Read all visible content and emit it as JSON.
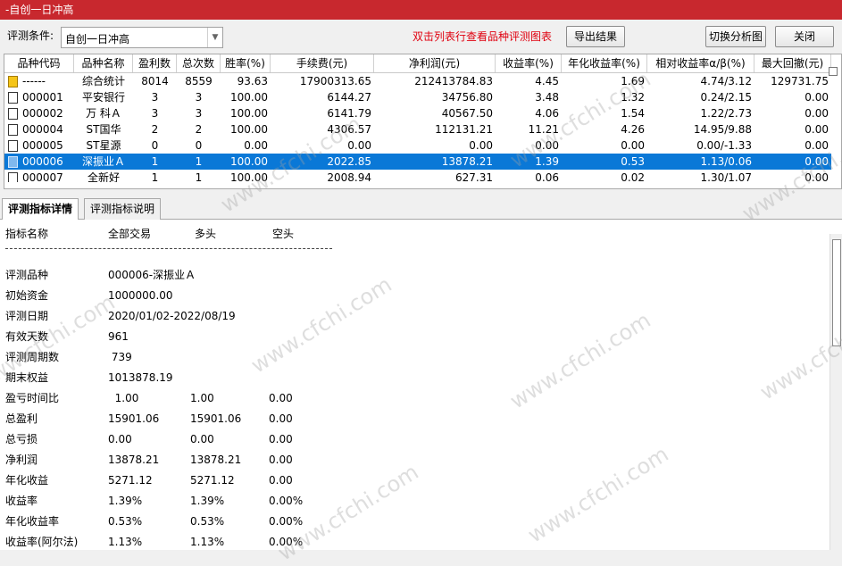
{
  "window": {
    "title": "-自创一日冲高"
  },
  "toolbar": {
    "condition_label": "评测条件:",
    "condition_value": "自创一日冲高",
    "hint": "双击列表行查看品种评测图表",
    "export_label": "导出结果",
    "switch_label": "切换分析图",
    "close_label": "关闭"
  },
  "grid": {
    "columns": [
      "品种代码",
      "品种名称",
      "盈利数",
      "总次数",
      "胜率(%)",
      "手续费(元)",
      "净利润(元)",
      "收益率(%)",
      "年化收益率(%)",
      "相对收益率α/β(%)",
      "最大回撤(元)"
    ],
    "rows": [
      {
        "code": "------",
        "name": "综合统计",
        "win": "8014",
        "total": "8559",
        "rate": "93.63",
        "fee": "17900313.65",
        "profit": "212413784.83",
        "ret": "4.45",
        "annual": "1.69",
        "rel": "4.74/3.12",
        "dd": "129731.75",
        "summary": true
      },
      {
        "code": "000001",
        "name": "平安银行",
        "win": "3",
        "total": "3",
        "rate": "100.00",
        "fee": "6144.27",
        "profit": "34756.80",
        "ret": "3.48",
        "annual": "1.32",
        "rel": "0.24/2.15",
        "dd": "0.00"
      },
      {
        "code": "000002",
        "name": "万 科Ａ",
        "win": "3",
        "total": "3",
        "rate": "100.00",
        "fee": "6141.79",
        "profit": "40567.50",
        "ret": "4.06",
        "annual": "1.54",
        "rel": "1.22/2.73",
        "dd": "0.00"
      },
      {
        "code": "000004",
        "name": "ST国华",
        "win": "2",
        "total": "2",
        "rate": "100.00",
        "fee": "4306.57",
        "profit": "112131.21",
        "ret": "11.21",
        "annual": "4.26",
        "rel": "14.95/9.88",
        "dd": "0.00"
      },
      {
        "code": "000005",
        "name": "ST星源",
        "win": "0",
        "total": "0",
        "rate": "0.00",
        "fee": "0.00",
        "profit": "0.00",
        "ret": "0.00",
        "annual": "0.00",
        "rel": "0.00/-1.33",
        "dd": "0.00"
      },
      {
        "code": "000006",
        "name": "深振业Ａ",
        "win": "1",
        "total": "1",
        "rate": "100.00",
        "fee": "2022.85",
        "profit": "13878.21",
        "ret": "1.39",
        "annual": "0.53",
        "rel": "1.13/0.06",
        "dd": "0.00",
        "selected": true
      },
      {
        "code": "000007",
        "name": "全新好",
        "win": "1",
        "total": "1",
        "rate": "100.00",
        "fee": "2008.94",
        "profit": "627.31",
        "ret": "0.06",
        "annual": "0.02",
        "rel": "1.30/1.07",
        "dd": "0.00"
      }
    ]
  },
  "tabs": [
    "评测指标详情",
    "评测指标说明"
  ],
  "detail": {
    "headers": [
      "指标名称",
      "全部交易",
      "多头",
      "空头"
    ],
    "rows": [
      {
        "label": "评测品种",
        "v1": "000006-深振业Ａ",
        "v2": "",
        "v3": ""
      },
      {
        "label": "初始资金",
        "v1": "1000000.00",
        "v2": "",
        "v3": ""
      },
      {
        "label": "评测日期",
        "v1": "2020/01/02-2022/08/19",
        "v2": "",
        "v3": ""
      },
      {
        "label": "有效天数",
        "v1": "961",
        "v2": "",
        "v3": ""
      },
      {
        "label": "评测周期数",
        "v1": " 739",
        "v2": "",
        "v3": ""
      },
      {
        "label": "期末权益",
        "v1": "1013878.19",
        "v2": "",
        "v3": ""
      },
      {
        "label": "盈亏时间比",
        "v1": "  1.00",
        "v2": "1.00",
        "v3": "0.00"
      },
      {
        "label": "总盈利",
        "v1": "15901.06",
        "v2": "15901.06",
        "v3": "0.00"
      },
      {
        "label": "总亏损",
        "v1": "0.00",
        "v2": "0.00",
        "v3": "0.00"
      },
      {
        "label": "净利润",
        "v1": "13878.21",
        "v2": "13878.21",
        "v3": "0.00"
      },
      {
        "label": "年化收益",
        "v1": "5271.12",
        "v2": "5271.12",
        "v3": "0.00"
      },
      {
        "label": "收益率",
        "v1": "1.39%",
        "v2": "1.39%",
        "v3": "0.00%"
      },
      {
        "label": "年化收益率",
        "v1": "0.53%",
        "v2": "0.53%",
        "v3": "0.00%"
      },
      {
        "label": "收益率(阿尔法)",
        "v1": "1.13%",
        "v2": "1.13%",
        "v3": "0.00%"
      }
    ]
  },
  "watermark": "www.cfchi.com",
  "colors": {
    "title_bar": "#c8282e",
    "selection": "#0a78d7",
    "hint": "#e0000f"
  }
}
